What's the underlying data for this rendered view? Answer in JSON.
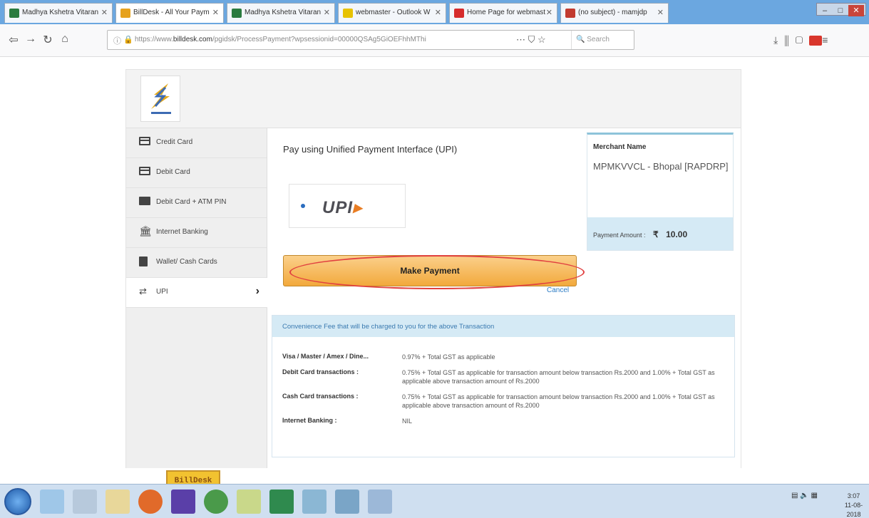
{
  "browser": {
    "tabs": [
      {
        "label": "Madhya Kshetra Vitaran",
        "color": "#2a7b3f"
      },
      {
        "label": "BillDesk - All Your Paym",
        "color": "#e6a21e"
      },
      {
        "label": "Madhya Kshetra Vitaran",
        "color": "#2a7b3f"
      },
      {
        "label": "webmaster - Outlook W",
        "color": "#e7c200"
      },
      {
        "label": "Home Page for webmast",
        "color": "#d62c2c"
      },
      {
        "label": "(no subject) - mamjdp",
        "color": "#c23b2f"
      }
    ],
    "url_prefix": "https://www.",
    "url_domain": "billdesk.com",
    "url_path": "/pgidsk/ProcessPayment?wpsessionid=00000QSAg5GiOEFhhMThi",
    "search_placeholder": "Search",
    "page_actions": "⋯ ⛉ ☆"
  },
  "sidebar": {
    "items": [
      {
        "label": "Credit Card",
        "icon": "credit-card-icon"
      },
      {
        "label": "Debit Card",
        "icon": "debit-card-icon"
      },
      {
        "label": "Debit Card + ATM PIN",
        "icon": "atm-card-icon"
      },
      {
        "label": "Internet Banking",
        "icon": "bank-icon"
      },
      {
        "label": "Wallet/ Cash Cards",
        "icon": "wallet-icon"
      },
      {
        "label": "UPI",
        "icon": "upi-icon"
      }
    ],
    "active_index": 5,
    "brand": "BillDesk"
  },
  "main": {
    "title": "Pay using Unified Payment Interface (UPI)",
    "upi_logo_text": "UPI",
    "pay_button": "Make Payment",
    "cancel": "Cancel"
  },
  "merchant": {
    "label": "Merchant Name",
    "name": "MPMKVVCL - Bhopal [RAPDRP]",
    "amount_label": "Payment Amount :",
    "currency": "₹",
    "amount": "10.00"
  },
  "convenience": {
    "heading": "Convenience Fee that will be charged to you for the above Transaction",
    "rows": [
      {
        "key": "Visa / Master / Amex / Dine...",
        "value": "0.97% + Total GST as applicable"
      },
      {
        "key": "Debit Card transactions :",
        "value": "0.75% + Total GST as applicable for transaction amount below transaction Rs.2000 and 1.00% + Total GST as applicable above transaction amount of Rs.2000"
      },
      {
        "key": "Cash Card transactions :",
        "value": "0.75% + Total GST as applicable for transaction amount below transaction Rs.2000 and 1.00% + Total GST as applicable above transaction amount of Rs.2000"
      },
      {
        "key": "Internet Banking :",
        "value": "NIL"
      }
    ]
  },
  "taskbar": {
    "time": "3:07",
    "date": "11-08-2018"
  }
}
